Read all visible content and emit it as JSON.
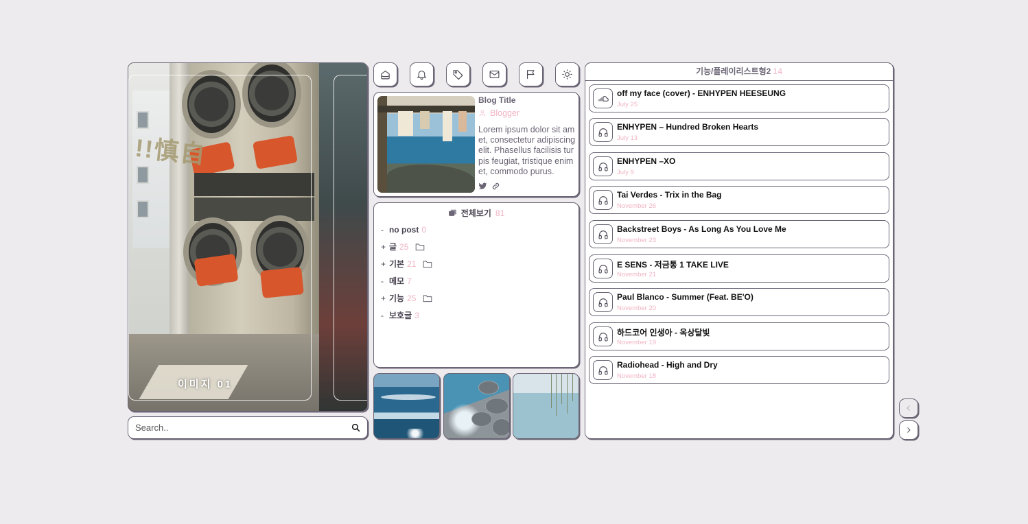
{
  "hero": {
    "caption": "이미지 01",
    "sign_text": "!!慎自"
  },
  "search": {
    "placeholder": "Search.."
  },
  "toolbar": {
    "icons": [
      "home-icon",
      "bell-icon",
      "tag-icon",
      "mail-icon",
      "flag-icon",
      "sun-icon"
    ]
  },
  "profile": {
    "title": "Blog Title",
    "author": "Blogger",
    "description": "Lorem ipsum dolor sit amet, consectetur adipiscing elit. Phasellus facilisis turpis feugiat, tristique enim et, commodo purus.",
    "social": [
      "twitter-icon",
      "link-icon"
    ]
  },
  "categories": {
    "header": "전체보기",
    "total": "81",
    "items": [
      {
        "mark": "-",
        "name": "no post",
        "count": "0",
        "folder": false
      },
      {
        "mark": "+",
        "name": "글",
        "count": "25",
        "folder": true
      },
      {
        "mark": "+",
        "name": "기본",
        "count": "21",
        "folder": true
      },
      {
        "mark": "-",
        "name": "메모",
        "count": "7",
        "folder": false
      },
      {
        "mark": "+",
        "name": "기능",
        "count": "25",
        "folder": true
      },
      {
        "mark": "-",
        "name": "보호글",
        "count": "3",
        "folder": false
      }
    ]
  },
  "playlist": {
    "header": "기능/플레이리스트형2",
    "count": "14",
    "items": [
      {
        "title": "off my face (cover) - ENHYPEN HEESEUNG",
        "date": "July 25",
        "icon": "soundcloud-icon"
      },
      {
        "title": "ENHYPEN – Hundred Broken Hearts",
        "date": "July 13",
        "icon": "headphones-icon"
      },
      {
        "title": "ENHYPEN –XO",
        "date": "July 9",
        "icon": "headphones-icon"
      },
      {
        "title": "Tai Verdes - Trix in the Bag",
        "date": "November 26",
        "icon": "headphones-icon"
      },
      {
        "title": "Backstreet Boys - As Long As You Love Me",
        "date": "November 23",
        "icon": "headphones-icon"
      },
      {
        "title": "E SENS - 저금통 1 TAKE LIVE",
        "date": "November 21",
        "icon": "headphones-icon"
      },
      {
        "title": "Paul Blanco - Summer (Feat. BE'O)",
        "date": "November 20",
        "icon": "headphones-icon"
      },
      {
        "title": "하드코어 인생아 - 옥상달빛",
        "date": "November 19",
        "icon": "headphones-icon"
      },
      {
        "title": "Radiohead - High and Dry",
        "date": "November 18",
        "icon": "headphones-icon"
      }
    ]
  },
  "colors": {
    "accent_pink": "#f1b4c4",
    "border": "#6b6575",
    "background": "#edebee"
  }
}
